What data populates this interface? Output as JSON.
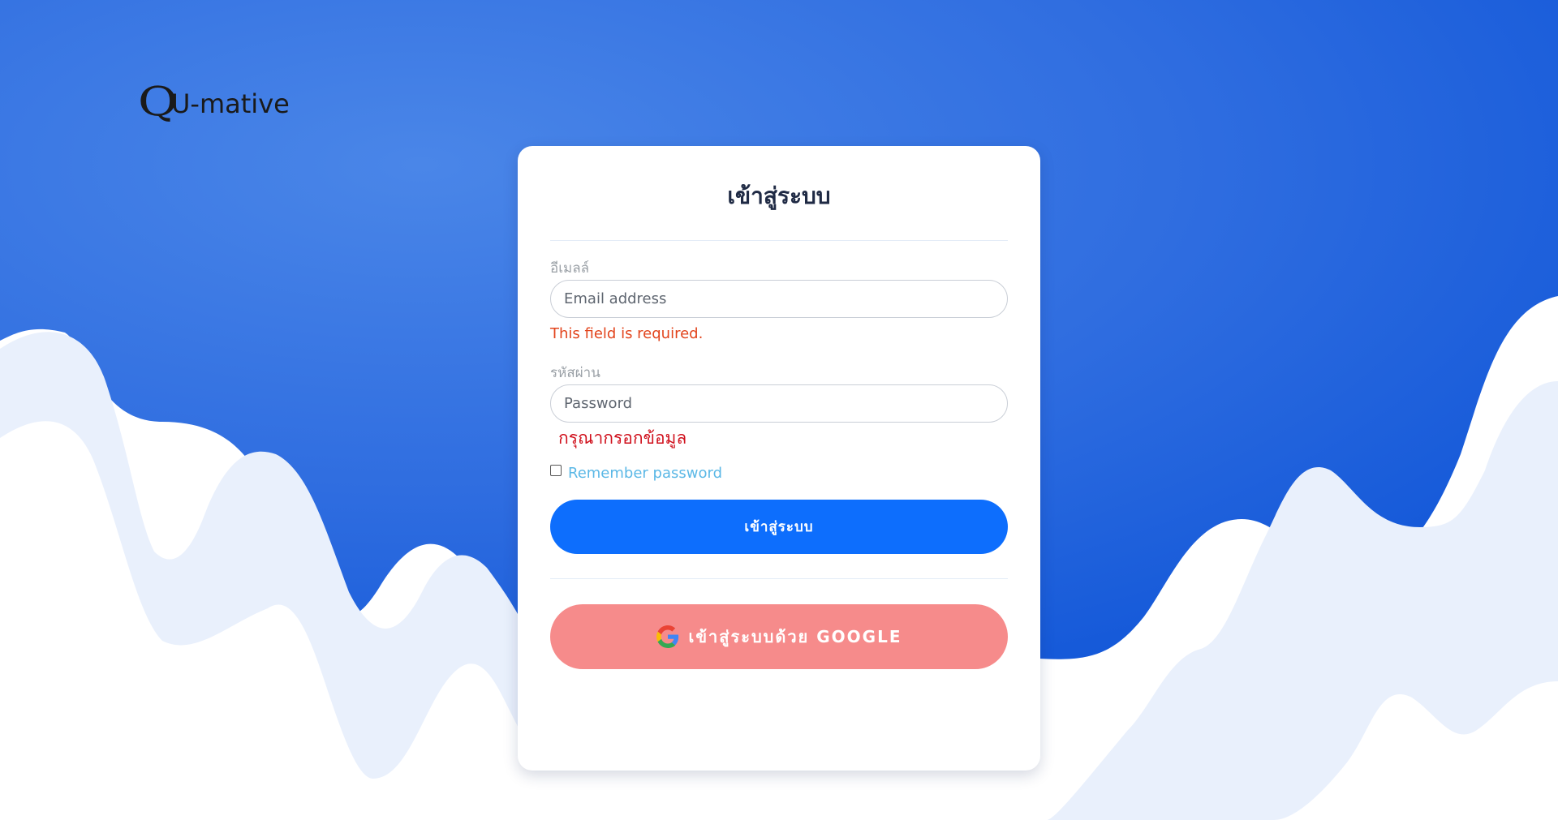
{
  "brand": {
    "logo_mark": "Q",
    "logo_text": "U-mative"
  },
  "login": {
    "title": "เข้าสู่ระบบ",
    "email_label": "อีเมลล์",
    "email_placeholder": "Email address",
    "email_value": "",
    "email_error": "This field is required.",
    "password_label": "รหัสผ่าน",
    "password_placeholder": "Password",
    "password_value": "",
    "password_error": "กรุณากรอกข้อมูล",
    "remember_label": "Remember password",
    "remember_checked": false,
    "submit_label": "เข้าสู่ระบบ",
    "google_label": "เข้าสู่ระบบด้วย GOOGLE"
  },
  "colors": {
    "bg_blue": "#2f6fe0",
    "wave_light": "#e9f0fc",
    "primary": "#0d6efd",
    "google_btn": "#f68b8b",
    "error_en": "#e2441c",
    "error_th": "#d0101c",
    "remember_text": "#5bb8e6"
  },
  "icons": {
    "google": "google-g-icon",
    "checkbox": "checkbox-icon"
  }
}
